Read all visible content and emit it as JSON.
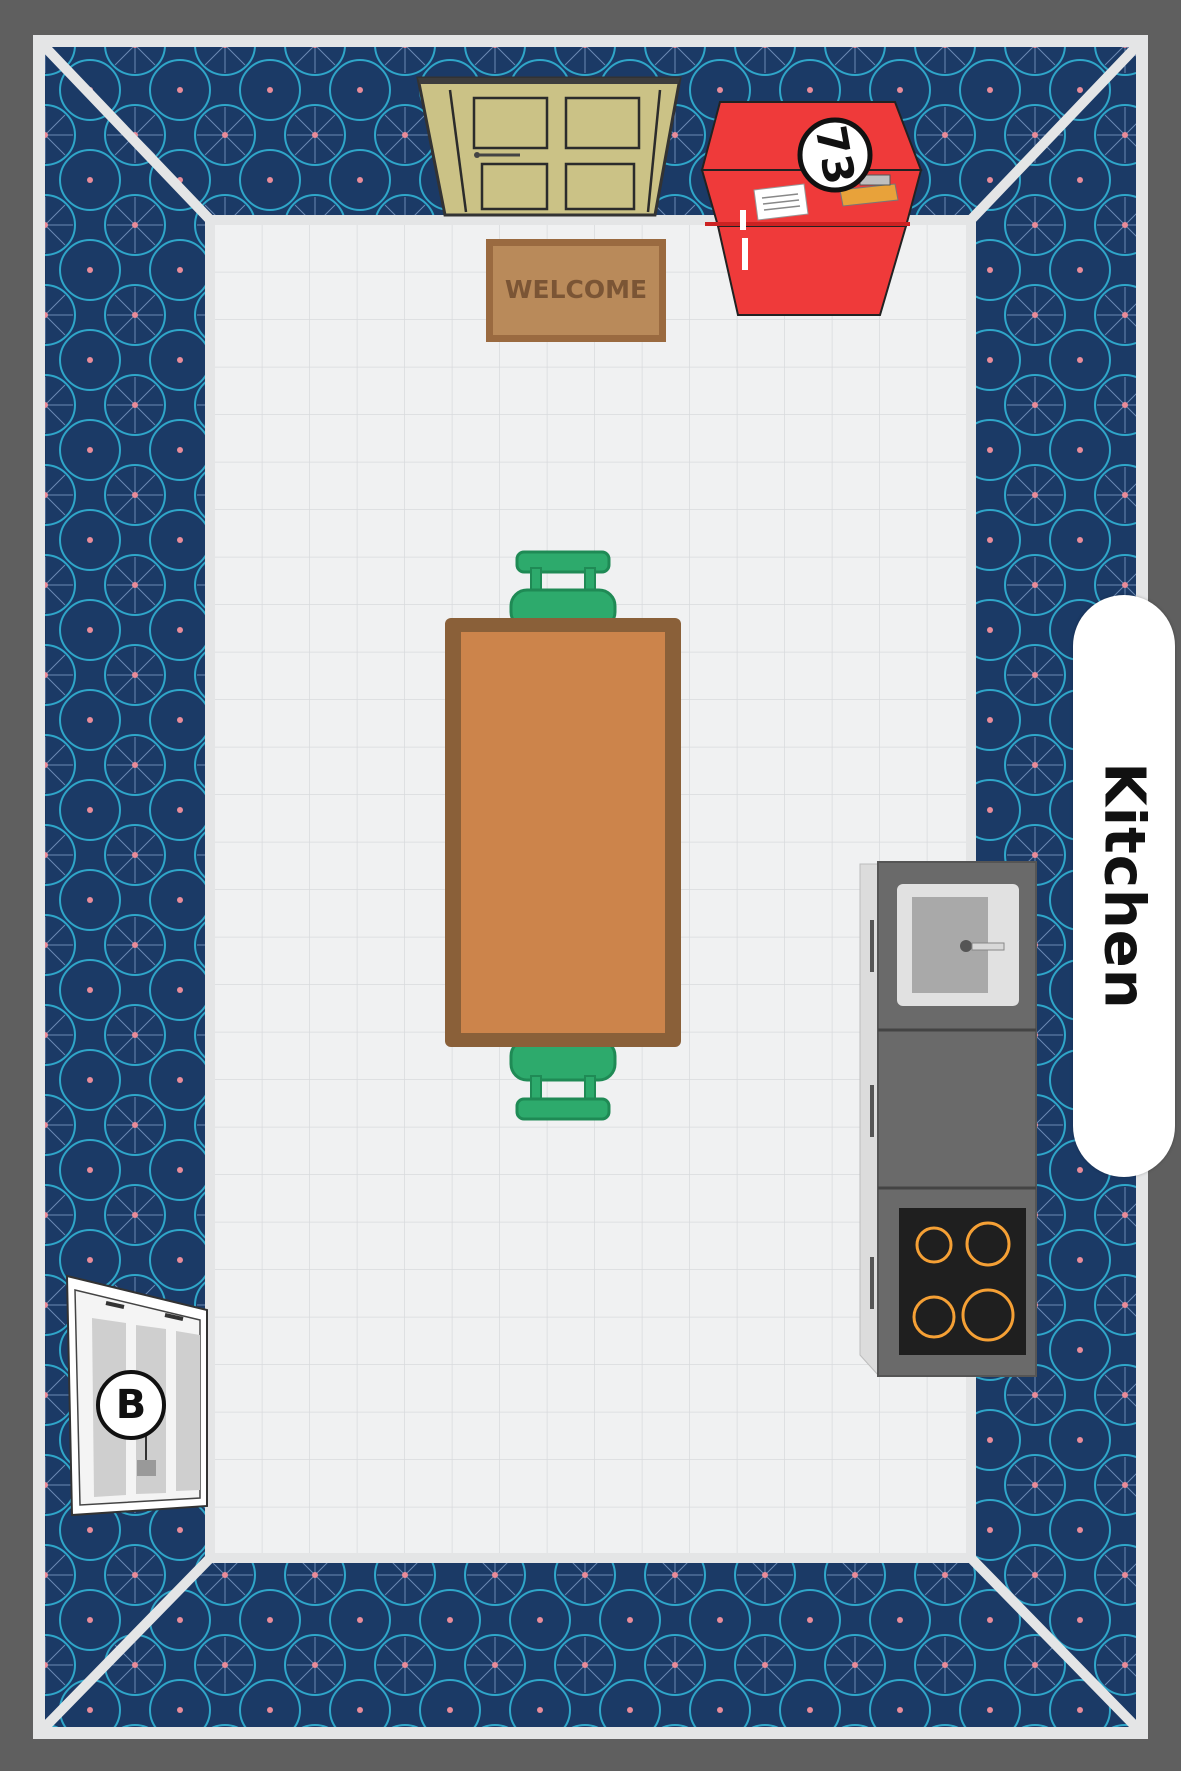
{
  "room": {
    "label": "Kitchen"
  },
  "objects": {
    "door_mat_text": "WELCOME",
    "fridge_number": "73",
    "hotspot_letter": "B"
  },
  "colors": {
    "background": "#5f5f5f",
    "wallpaper_base": "#1b3a66",
    "wallpaper_accent": "#2fa6c9",
    "floor_tile": "#f0f1f2",
    "fridge": "#ef3a3a",
    "door": "#cbc286",
    "table": "#cc844b",
    "table_border": "#8a6039",
    "chair": "#2daa6c",
    "counter": "#6a6a6a",
    "stovetop": "#1f1f1f",
    "burner": "#f5a035"
  }
}
